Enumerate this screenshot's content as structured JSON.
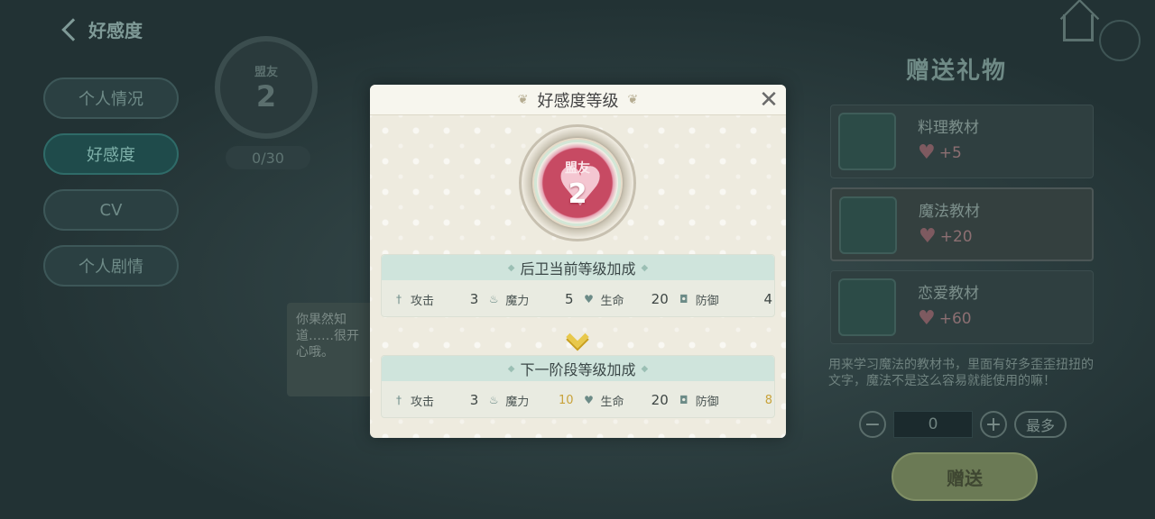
{
  "background": {
    "back_label": "好感度",
    "side_menu": [
      "个人情况",
      "好感度",
      "CV",
      "个人剧情"
    ],
    "badge_label": "盟友",
    "badge_level": "2",
    "progress": "0/30",
    "quote": "你果然知道……很开心哦。",
    "right_title": "赠送礼物",
    "gifts": [
      {
        "name": "料理教材",
        "value": "+5"
      },
      {
        "name": "魔法教材",
        "value": "+20"
      },
      {
        "name": "恋爱教材",
        "value": "+60"
      }
    ],
    "description": "用来学习魔法的教材书，里面有好多歪歪扭扭的文字，魔法不是这么容易就能使用的嘛！",
    "quantity": "0",
    "max_label": "最多",
    "give_label": "赠送"
  },
  "modal": {
    "title": "好感度等级",
    "close_icon": "close-icon",
    "level_label": "盟友",
    "level": "2",
    "current": {
      "header": "后卫当前等级加成",
      "stats": [
        {
          "icon": "sword-icon",
          "label": "攻击",
          "value": "3"
        },
        {
          "icon": "flame-icon",
          "label": "魔力",
          "value": "5"
        },
        {
          "icon": "heart-icon",
          "label": "生命",
          "value": "20"
        },
        {
          "icon": "shield-icon",
          "label": "防御",
          "value": "4"
        }
      ]
    },
    "next": {
      "header": "下一阶段等级加成",
      "stats": [
        {
          "icon": "sword-icon",
          "label": "攻击",
          "value": "3"
        },
        {
          "icon": "flame-icon",
          "label": "魔力",
          "value": "10"
        },
        {
          "icon": "heart-icon",
          "label": "生命",
          "value": "20"
        },
        {
          "icon": "shield-icon",
          "label": "防御",
          "value": "8"
        }
      ]
    }
  },
  "colors": {
    "accent_gold": "#e8c84b",
    "heart_pink": "#c74a63",
    "panel_header": "#cfe4dc"
  }
}
